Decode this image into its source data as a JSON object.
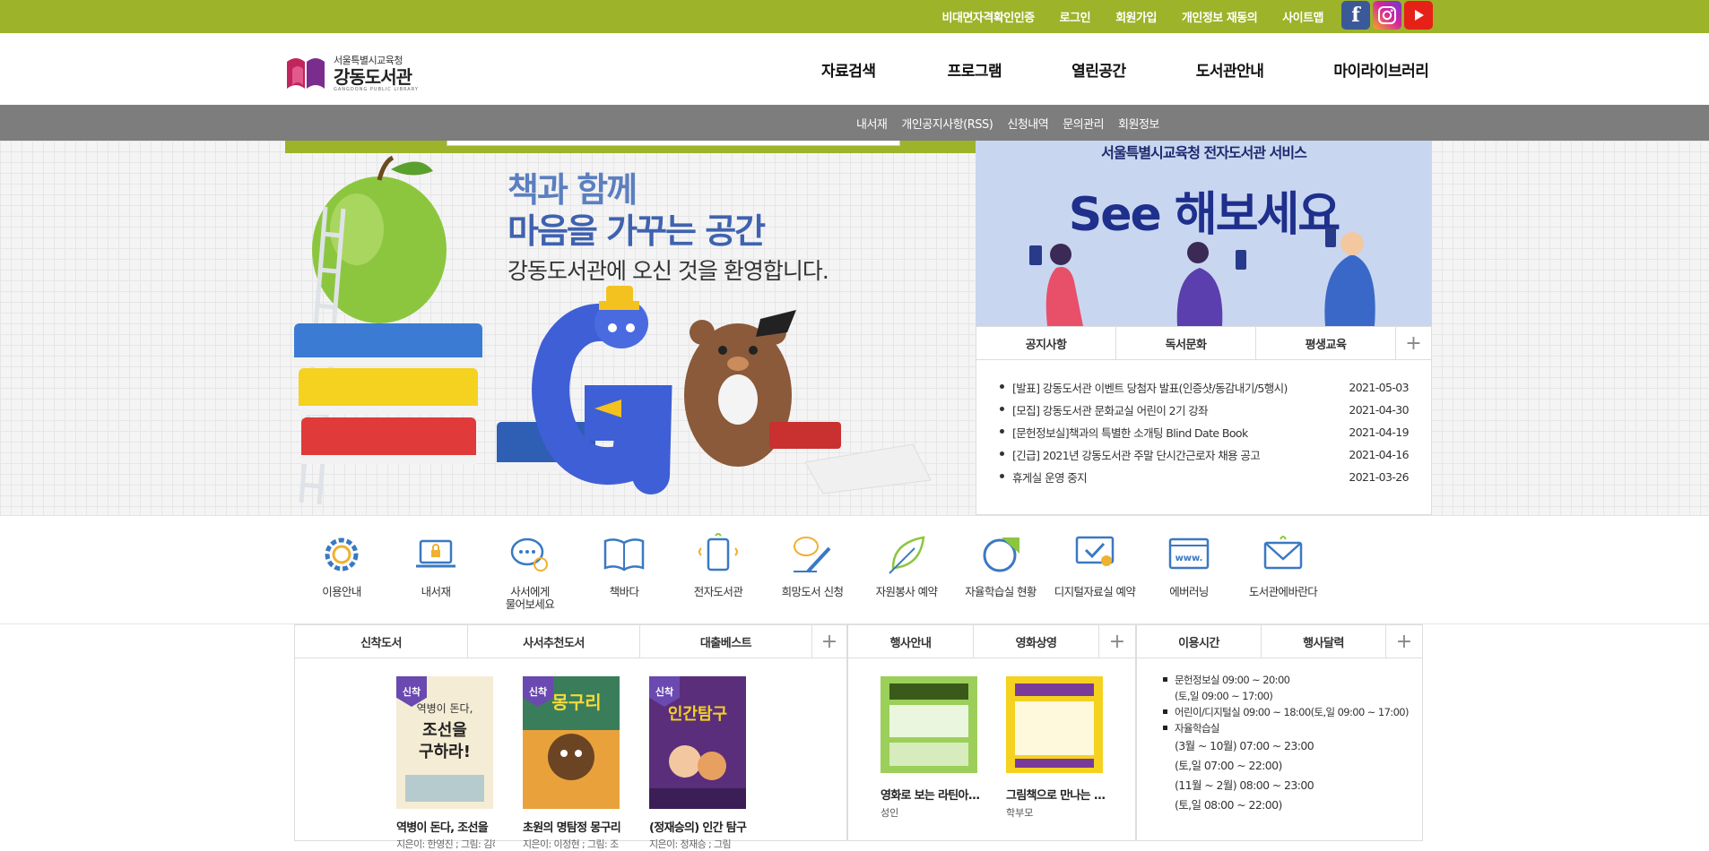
{
  "topbar": {
    "links": [
      "비대면자격확인인증",
      "로그인",
      "회원가입",
      "개인정보 재동의",
      "사이트맵"
    ],
    "sns": [
      "facebook-icon",
      "instagram-icon",
      "youtube-icon"
    ],
    "color": "#9cb32a"
  },
  "header": {
    "logo_sub": "서울특별시교육청",
    "logo_name": "강동도서관",
    "logo_eng": "GANGDONG PUBLIC LIBRARY",
    "gnb": [
      "자료검색",
      "프로그램",
      "열린공간",
      "도서관안내",
      "마이라이브러리"
    ]
  },
  "subbar": {
    "links": [
      "내서재",
      "개인공지사항(RSS)",
      "신청내역",
      "문의관리",
      "회원정보"
    ]
  },
  "visual": {
    "line1": "책과 함께",
    "line2": "마음을 가꾸는 공간",
    "line3": "강동도서관에 오신 것을 환영합니다."
  },
  "banner": {
    "line1": "서울특별시교육청 전자도서관 서비스",
    "line2": "See 해보세요"
  },
  "notice": {
    "tabs": [
      "공지사항",
      "독서문화",
      "평생교육"
    ],
    "items": [
      {
        "title": "[발표] 강동도서관 이벤트 당첨자 발표(인증샷/동감내기/5행시)",
        "date": "2021-05-03"
      },
      {
        "title": "[모집] 강동도서관 문화교실 어린이 2기 강좌",
        "date": "2021-04-30"
      },
      {
        "title": "[문헌정보실]책과의 특별한 소개팅 Blind Date Book",
        "date": "2021-04-19"
      },
      {
        "title": "[긴급] 2021년 강동도서관 주말 단시간근로자 채용 공고",
        "date": "2021-04-16"
      },
      {
        "title": "휴게실 운영 중지",
        "date": "2021-03-26"
      }
    ]
  },
  "quick": [
    {
      "label": "이용안내"
    },
    {
      "label": "내서재"
    },
    {
      "label": "사서에게\n물어보세요"
    },
    {
      "label": "책바다"
    },
    {
      "label": "전자도서관"
    },
    {
      "label": "희망도서 신청"
    },
    {
      "label": "자원봉사 예약"
    },
    {
      "label": "자율학습실 현황"
    },
    {
      "label": "디지털자료실 예약"
    },
    {
      "label": "에버러닝"
    },
    {
      "label": "도서관에바란다"
    }
  ],
  "books": {
    "tabs": [
      "신착도서",
      "사서추천도서",
      "대출베스트"
    ],
    "badge": "신착",
    "items": [
      {
        "title": "역병이 돈다, 조선을",
        "author": "지은이: 한영진 ; 그림: 김하"
      },
      {
        "title": "초원의 명탐정 몽구리",
        "author": "지은이: 이정현 ; 그림: 조"
      },
      {
        "title": "(정재승의) 인간 탐구",
        "author": "지은이: 정재승 ; 그림"
      }
    ]
  },
  "events": {
    "tabs": [
      "행사안내",
      "영화상영"
    ],
    "items": [
      {
        "title": "영화로 보는 라틴아...",
        "sub": "성인"
      },
      {
        "title": "그림책으로 만나는 ...",
        "sub": "학부모"
      }
    ]
  },
  "hours": {
    "tabs": [
      "이용시간",
      "행사달력"
    ],
    "lines": [
      "문헌정보실 09:00 ~ 20:00",
      "(토,일 09:00 ~ 17:00)",
      "어린이/디지털실 09:00 ~ 18:00(토,일 09:00 ~ 17:00)",
      "자율학습실",
      "(3월 ~ 10월) 07:00 ~ 23:00",
      "(토,일 07:00 ~ 22:00)",
      "(11월 ~ 2월) 08:00 ~ 23:00",
      "(토,일 08:00 ~ 22:00)"
    ]
  }
}
